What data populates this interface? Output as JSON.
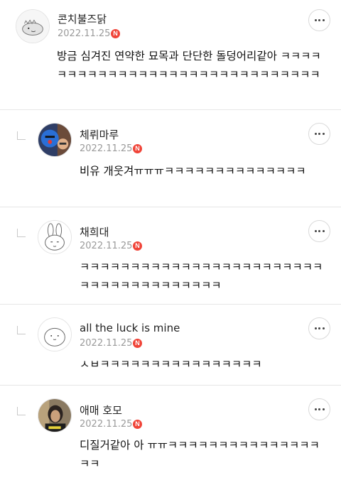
{
  "comments": [
    {
      "author": "콘치불즈닭",
      "date": "2022.11.25",
      "badge": "N",
      "text": "방금 심겨진 연약한 묘목과 단단한 돌덩어리같아 ㅋㅋㅋㅋㅋㅋㅋㅋㅋㅋㅋㅋㅋㅋㅋㅋㅋㅋㅋㅋㅋㅋㅋㅋㅋㅋㅋㅋㅋㅋ",
      "avatar_icon": "dinosaur-doodle-avatar"
    },
    {
      "author": "체뤼마루",
      "date": "2022.11.25",
      "badge": "N",
      "text": "비유 개웃겨ㅠㅠㅠㅋㅋㅋㅋㅋㅋㅋㅋㅋㅋㅋㅋㅋㅋ",
      "avatar_icon": "character-photo-avatar"
    },
    {
      "author": "채희대",
      "date": "2022.11.25",
      "badge": "N",
      "text": "ㅋㅋㅋㅋㅋㅋㅋㅋㅋㅋㅋㅋㅋㅋㅋㅋㅋㅋㅋㅋㅋㅋㅋㅋㅋㅋㅋㅋㅋㅋㅋㅋㅋㅋㅋㅋㅋㅋ",
      "avatar_icon": "bunny-doodle-avatar"
    },
    {
      "author": "all the luck is mine",
      "date": "2022.11.25",
      "badge": "N",
      "text": "ㅅㅂㅋㅋㅋㅋㅋㅋㅋㅋㅋㅋㅋㅋㅋㅋㅋㅋ",
      "avatar_icon": "blob-doodle-avatar"
    },
    {
      "author": "애매 호모",
      "date": "2022.11.25",
      "badge": "N",
      "text": "디질거같아 아 ㅠㅠㅋㅋㅋㅋㅋㅋㅋㅋㅋㅋㅋㅋㅋㅋㅋㅋㅋ",
      "avatar_icon": "person-photo-avatar"
    }
  ],
  "colors": {
    "badge": "#f04438",
    "date": "#9a9a9a",
    "divider": "#e6e6e6"
  },
  "icons": {
    "more": "more-options-icon",
    "reply": "reply-indent-icon",
    "new": "new-badge-icon"
  }
}
